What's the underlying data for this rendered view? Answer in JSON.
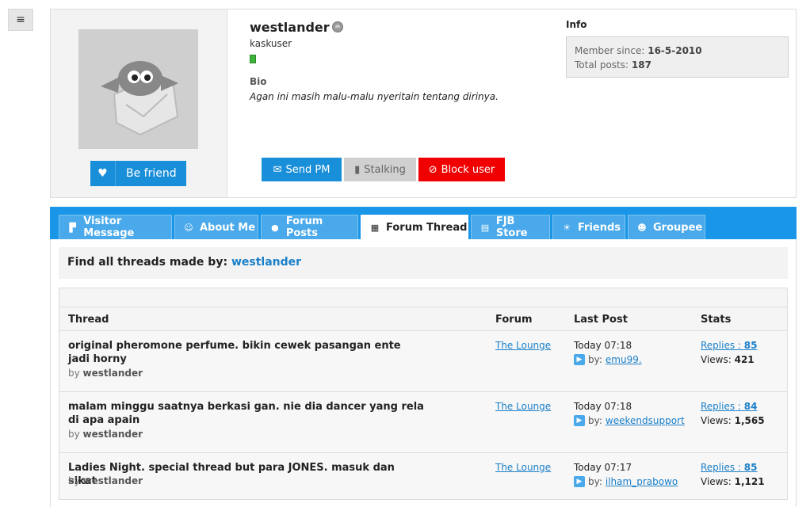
{
  "menu": {
    "icon": "hamburger-icon",
    "glyph": "≡"
  },
  "profile": {
    "username": "westlander",
    "user_title": "kaskuser",
    "bio_heading": "Bio",
    "bio_text": "Agan ini masih malu-malu nyeritain tentang dirinya.",
    "befriend_label": "Be friend",
    "send_pm_label": "Send PM",
    "stalking_label": "Stalking",
    "block_label": "Block user",
    "info_heading": "Info",
    "member_since_label": "Member since:",
    "member_since_value": "16-5-2010",
    "total_posts_label": "Total posts:",
    "total_posts_value": "187"
  },
  "tabs": [
    {
      "label": "Visitor Message",
      "icon": "message-icon",
      "active": false
    },
    {
      "label": "About Me",
      "icon": "user-icon",
      "active": false
    },
    {
      "label": "Forum Posts",
      "icon": "chat-icon",
      "active": false
    },
    {
      "label": "Forum Thread",
      "icon": "calendar-icon",
      "active": true
    },
    {
      "label": "FJB Store",
      "icon": "cart-icon",
      "active": false
    },
    {
      "label": "Friends",
      "icon": "bulb-icon",
      "active": false
    },
    {
      "label": "Groupee",
      "icon": "group-icon",
      "active": false
    }
  ],
  "find": {
    "prefix": "Find all threads made by:",
    "user": "westlander"
  },
  "table": {
    "headers": {
      "thread": "Thread",
      "forum": "Forum",
      "last_post": "Last Post",
      "stats": "Stats"
    },
    "by_label": "by",
    "lp_by_label": "by:",
    "replies_label": "Replies :",
    "views_label": "Views:",
    "rows": [
      {
        "title": "original pheromone perfume. bikin cewek pasangan ente jadi horny",
        "author": "westlander",
        "forum": "The Lounge",
        "last_time": "Today 07:18",
        "last_user": "emu99.",
        "replies": "85",
        "views": "421"
      },
      {
        "title": "malam minggu saatnya berkasi gan. nie dia dancer yang rela di apa apain",
        "author": "westlander",
        "forum": "The Lounge",
        "last_time": "Today 07:18",
        "last_user": "weekendsupport",
        "replies": "84",
        "views": "1,565"
      },
      {
        "title": "Ladies Night. special thread but para JONES. masuk dan sikat",
        "author": "westlander",
        "forum": "The Lounge",
        "last_time": "Today 07:17",
        "last_user": "ilham_prabowo",
        "replies": "85",
        "views": "1,121"
      }
    ]
  }
}
